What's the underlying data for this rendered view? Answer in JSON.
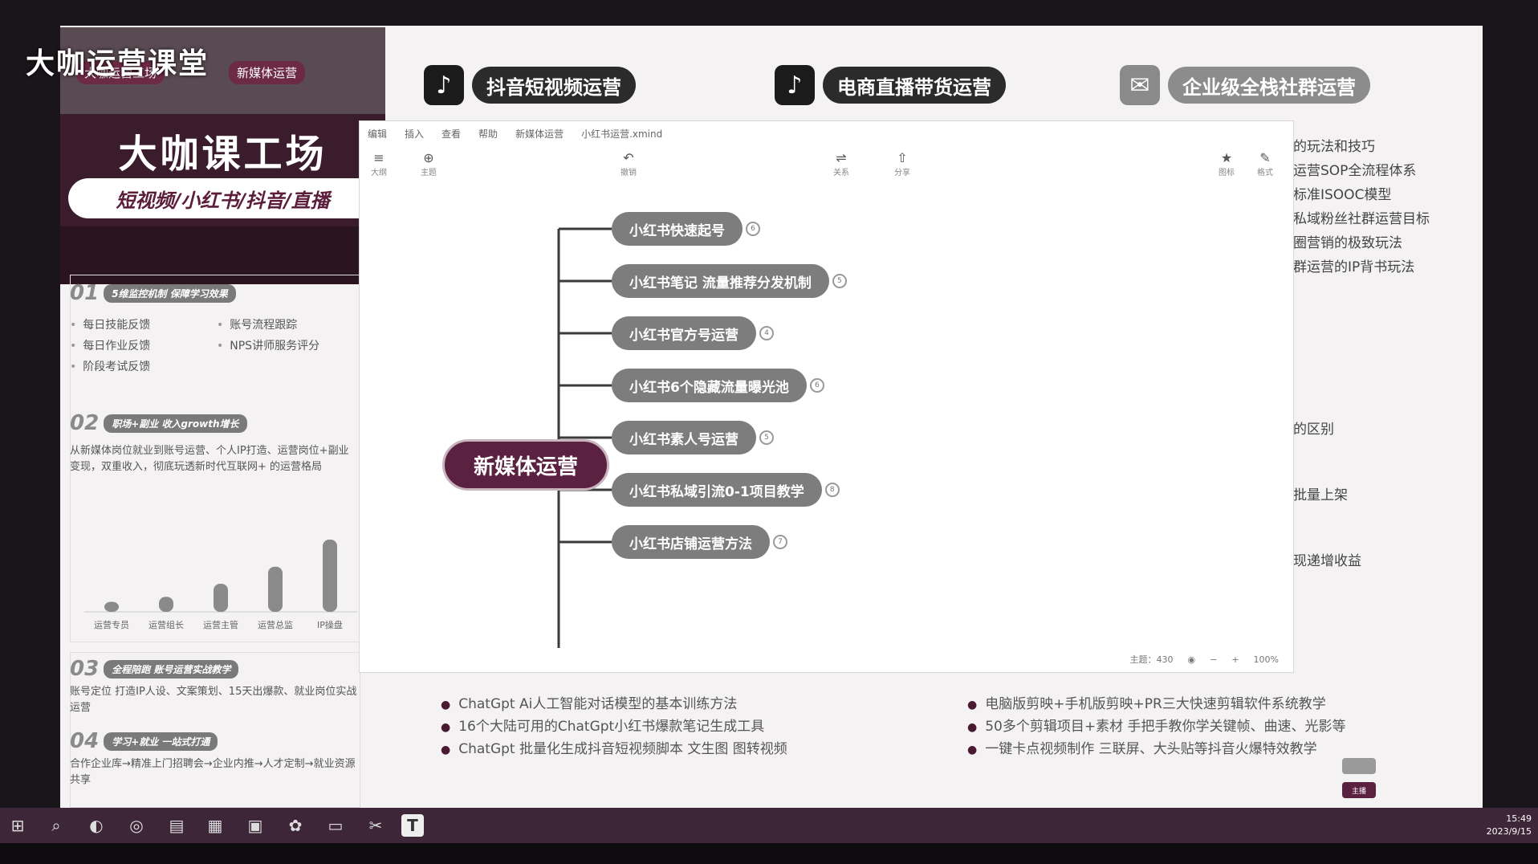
{
  "watermark": "大咖运营课堂",
  "top_pills": [
    {
      "icon": "tiktok-icon",
      "label": "抖音短视频运营"
    },
    {
      "icon": "tiktok-icon",
      "label": "电商直播带货运营"
    },
    {
      "icon": "wechat-icon",
      "label": "企业级全栈社群运营"
    }
  ],
  "video": {
    "mini_left": "大咖运营工场",
    "mini_right": "新媒体运营",
    "title": "大咖课工场",
    "subtitle": "短视频/小红书/抖音/直播"
  },
  "left": {
    "sec1": {
      "num": "01",
      "tag": "5维监控机制 保障学习效果",
      "bullets": [
        "每日技能反馈",
        "账号流程跟踪",
        "每日作业反馈",
        "NPS讲师服务评分",
        "阶段考试反馈"
      ]
    },
    "sec2": {
      "num": "02",
      "tag": "职场+副业 收入growth增长",
      "text": "从新媒体岗位就业到账号运营、个人IP打造、运营岗位+副业变现，双重收入，彻底玩透新时代互联网+ 的运营格局"
    },
    "bar_labels": [
      "运营专员",
      "运营组长",
      "运营主管",
      "运营总监",
      "IP操盘"
    ],
    "sec3": {
      "num": "03",
      "tag": "全程陪跑 账号运营实战教学",
      "text": "账号定位 打造IP人设、文案策划、15天出爆款、就业岗位实战运营"
    },
    "sec4": {
      "num": "04",
      "tag": "学习+就业 一站式打通",
      "text": "合作企业库→精准上门招聘会→企业内推→人才定制→就业资源共享"
    }
  },
  "chart_data": {
    "type": "bar",
    "categories": [
      "运营专员",
      "运营组长",
      "运营主管",
      "运营总监",
      "IP操盘"
    ],
    "values": [
      1,
      1.5,
      2.8,
      4.5,
      7.2
    ],
    "title": "",
    "xlabel": "",
    "ylabel": ""
  },
  "xmind": {
    "menu": [
      "编辑",
      "插入",
      "查看",
      "帮助",
      "新媒体运营",
      "小红书运营.xmind"
    ],
    "toolbar": [
      {
        "icon": "outline-icon",
        "label": "大纲"
      },
      {
        "icon": "topic-icon",
        "label": "主题"
      },
      {
        "icon": "undo-icon",
        "label": "撤销"
      },
      {
        "icon": "relation-icon",
        "label": "关系"
      },
      {
        "icon": "share-icon",
        "label": "分享"
      },
      {
        "icon": "star-icon",
        "label": "图标"
      },
      {
        "icon": "brush-icon",
        "label": "格式"
      }
    ],
    "root": "新媒体运营",
    "branches": [
      {
        "label": "小红书快速起号",
        "count": "6"
      },
      {
        "label": "小红书笔记 流量推荐分发机制",
        "count": "5"
      },
      {
        "label": "小红书官方号运营",
        "count": "4"
      },
      {
        "label": "小红书6个隐藏流量曝光池",
        "count": "6"
      },
      {
        "label": "小红书素人号运营",
        "count": "5"
      },
      {
        "label": "小红书私域引流0-1项目教学",
        "count": "8"
      },
      {
        "label": "小红书店铺运营方法",
        "count": "7"
      }
    ],
    "status": {
      "topic_count": "主题：430",
      "zoom": "100%"
    }
  },
  "right_list": [
    "的玩法和技巧",
    "运营SOP全流程体系",
    "标准ISOOC模型",
    "私域粉丝社群运营目标",
    "圈营销的极致玩法",
    "群运营的IP背书玩法",
    "的区别",
    "批量上架",
    "现递增收益"
  ],
  "features_left": [
    "ChatGpt Ai人工智能对话模型的基本训练方法",
    "16个大陆可用的ChatGpt小红书爆款笔记生成工具",
    "ChatGpt 批量化生成抖音短视频脚本 文生图 图转视频"
  ],
  "features_right": [
    "电脑版剪映+手机版剪映+PR三大快速剪辑软件系统教学",
    "50多个剪辑项目+素材 手把手教你学关键帧、曲速、光影等",
    "一键卡点视频制作 三联屏、大头贴等抖音火爆特效教学"
  ],
  "bottom_badges": [
    "",
    "主播"
  ],
  "taskbar": {
    "icons": [
      "windows-icon",
      "search-icon",
      "edge-icon",
      "browser-icon",
      "folder-icon",
      "file-icon",
      "image-icon",
      "app-icon",
      "video-icon",
      "tool-icon",
      "text-icon"
    ],
    "time": "15:49",
    "date": "2023/9/15"
  },
  "colors": {
    "brand": "#5a2240",
    "node": "#7d7d7d",
    "taskbar": "#3d2638"
  }
}
